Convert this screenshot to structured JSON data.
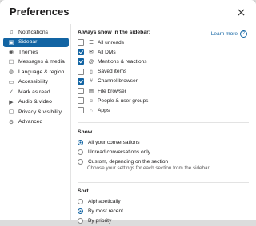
{
  "title": "Preferences",
  "nav": [
    {
      "label": "Notifications",
      "icon": "bell-icon",
      "glyph": "♫"
    },
    {
      "label": "Sidebar",
      "icon": "sidebar-icon",
      "glyph": "▣",
      "active": true
    },
    {
      "label": "Themes",
      "icon": "eye-icon",
      "glyph": "◉"
    },
    {
      "label": "Messages & media",
      "icon": "message-icon",
      "glyph": "☐"
    },
    {
      "label": "Language & region",
      "icon": "globe-icon",
      "glyph": "◍"
    },
    {
      "label": "Accessibility",
      "icon": "accessibility-icon",
      "glyph": "▭"
    },
    {
      "label": "Mark as read",
      "icon": "check-circle-icon",
      "glyph": "✓"
    },
    {
      "label": "Audio & video",
      "icon": "video-icon",
      "glyph": "▶"
    },
    {
      "label": "Privacy & visibility",
      "icon": "lock-icon",
      "glyph": "▢"
    },
    {
      "label": "Advanced",
      "icon": "gear-icon",
      "glyph": "⚙"
    }
  ],
  "always_show": {
    "title": "Always show in the sidebar:",
    "learn_more": "Learn more",
    "items": [
      {
        "label": "All unreads",
        "icon": "unreads-icon",
        "glyph": "☰",
        "checked": false
      },
      {
        "label": "All DMs",
        "icon": "dm-icon",
        "glyph": "✉",
        "checked": true
      },
      {
        "label": "Mentions & reactions",
        "icon": "at-icon",
        "glyph": "@",
        "checked": true
      },
      {
        "label": "Saved items",
        "icon": "bookmark-icon",
        "glyph": "▯",
        "checked": false
      },
      {
        "label": "Channel browser",
        "icon": "channel-browser-icon",
        "glyph": "#",
        "checked": true
      },
      {
        "label": "File browser",
        "icon": "file-icon",
        "glyph": "▤",
        "checked": false
      },
      {
        "label": "People & user groups",
        "icon": "people-icon",
        "glyph": "☺",
        "checked": false
      },
      {
        "label": "Apps",
        "icon": "apps-icon",
        "glyph": "⁙",
        "checked": false
      }
    ]
  },
  "show": {
    "title": "Show...",
    "options": [
      {
        "label": "All your conversations",
        "selected": true
      },
      {
        "label": "Unread conversations only",
        "selected": false
      },
      {
        "label": "Custom, depending on the section",
        "selected": false
      }
    ],
    "custom_note": "Choose your settings for each section from the sidebar"
  },
  "sort": {
    "title": "Sort...",
    "options": [
      {
        "label": "Alphabetically",
        "selected": false
      },
      {
        "label": "By most recent",
        "selected": true
      },
      {
        "label": "By priority",
        "selected": false
      }
    ]
  },
  "colors": {
    "accent": "#1264a3"
  }
}
